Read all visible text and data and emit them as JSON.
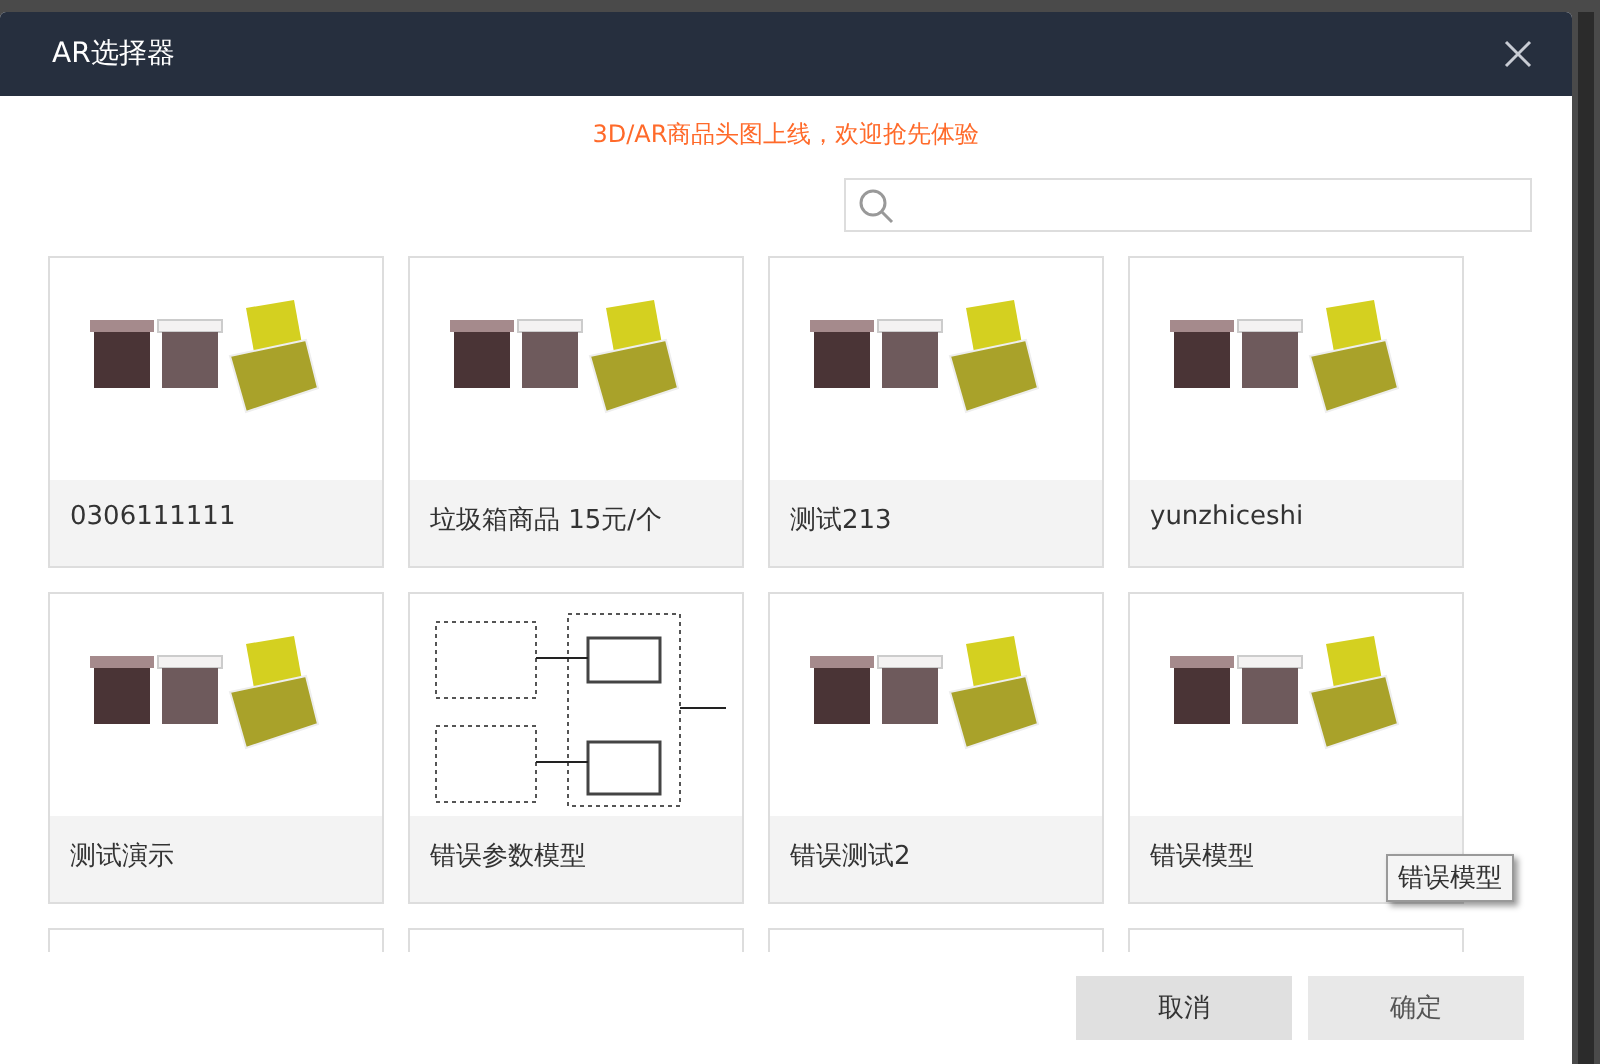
{
  "dialog": {
    "title": "AR选择器",
    "notice": "3D/AR商品头图上线，欢迎抢先体验"
  },
  "cards": [
    {
      "kind": "bins",
      "title": "0306111111"
    },
    {
      "kind": "bins",
      "title": "垃圾箱商品 15元/个"
    },
    {
      "kind": "bins",
      "title": "测试213"
    },
    {
      "kind": "bins",
      "title": "yunzhiceshi"
    },
    {
      "kind": "bins",
      "title": "测试演示"
    },
    {
      "kind": "diagram",
      "title": "错误参数模型"
    },
    {
      "kind": "bins",
      "title": "错误测试2"
    },
    {
      "kind": "bins",
      "title": "错误模型"
    },
    {
      "kind": "partial"
    },
    {
      "kind": "partial"
    },
    {
      "kind": "partial"
    },
    {
      "kind": "partial"
    }
  ],
  "tooltip": "错误模型",
  "buttons": [
    {
      "label": "取消",
      "kind": "cancel"
    },
    {
      "label": "确定",
      "kind": "confirm"
    }
  ]
}
